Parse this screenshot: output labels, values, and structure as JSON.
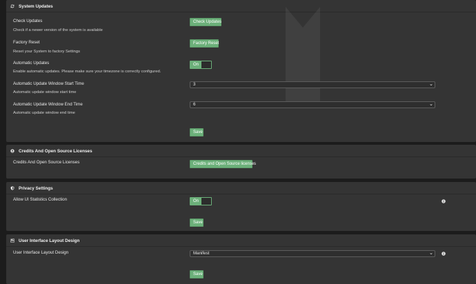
{
  "system_updates": {
    "title": "System Updates",
    "icon": "refresh-icon",
    "check_updates": {
      "label": "Check Updates",
      "description": "Check if a newer version of the system is available",
      "button": "Check Updates"
    },
    "factory_reset": {
      "label": "Factory Reset",
      "description": "Reset your System to factory Settings",
      "button": "Factory Reset"
    },
    "automatic_updates": {
      "label": "Automatic Updates",
      "description": "Enable automatic updates. Please make sure your timezone is correctly configured.",
      "toggle": "On"
    },
    "window_start": {
      "label": "Automatic Update Window Start Time",
      "description": "Automatic update window start time",
      "value": "3"
    },
    "window_end": {
      "label": "Automatic Update Window End Time",
      "description": "Automatic update window end time",
      "value": "6"
    },
    "save": "Save"
  },
  "credits": {
    "title": "Credits And Open Source Licenses",
    "icon": "user-circle-icon",
    "label": "Credits And Open Source Licenses",
    "button": "Credits and Open Source licenses"
  },
  "privacy": {
    "title": "Privacy Settings",
    "icon": "shield-icon",
    "label": "Allow UI Statistics Collection",
    "toggle": "On",
    "save": "Save"
  },
  "layout_design": {
    "title": "User Interface Layout Design",
    "icon": "layout-icon",
    "label": "User Interface Layout Design",
    "value": "Manifest",
    "save": "Save"
  },
  "colors": {
    "accent": "#6cb07a",
    "panel": "#343434",
    "background": "#1c1c1c"
  }
}
